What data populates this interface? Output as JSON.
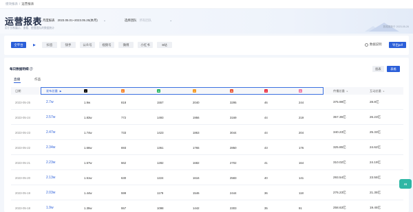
{
  "breadcrumb": {
    "parent": "绩效报表",
    "current": "运营报表"
  },
  "header": {
    "title": "运营报表",
    "subtitle": "用于分析展示、查看、经营团队的数据统计",
    "update_time": "数据更新于 2023-05-26"
  },
  "filters": {
    "period": {
      "label": "月度报表",
      "value": "2023.05.01~2023.05.25(本月)"
    },
    "team": {
      "label": "选择团队",
      "placeholder": "所有团队"
    }
  },
  "platform_filter": {
    "all_label": "全平台",
    "items": [
      "抖音",
      "快手",
      "公众号",
      "视频号",
      "微博",
      "小红书",
      "B站"
    ],
    "explain_label": "数据说明",
    "export_label": "导出pdf"
  },
  "table_section": {
    "title": "每日数据明细",
    "view_chart": "图表",
    "view_table": "表格",
    "subtabs": [
      "直播",
      "作品"
    ],
    "columns": {
      "date": "日期",
      "published": "发布总量",
      "followers": "传播总量",
      "interaction": "互动总量"
    },
    "platform_icons": [
      {
        "name": "douyin-icon",
        "color": "#111111",
        "glyph": "♪"
      },
      {
        "name": "kuaishou-icon",
        "color": "#f5822a",
        "glyph": "K"
      },
      {
        "name": "wechat-official-icon",
        "color": "#22b35e",
        "glyph": "W"
      },
      {
        "name": "channels-icon",
        "color": "#f59b23",
        "glyph": "∞"
      },
      {
        "name": "weibo-icon",
        "color": "#e8502f",
        "glyph": "W"
      },
      {
        "name": "xiaohongshu-icon",
        "color": "#e8283b",
        "glyph": "小"
      },
      {
        "name": "bilibili-icon",
        "color": "#f07aa6",
        "glyph": "B"
      }
    ],
    "rows": [
      {
        "date": "2023-05-25",
        "pub": "2.7w",
        "v": [
          "1.9w",
          "818",
          "1557",
          "2040",
          "3295",
          "46",
          "244"
        ],
        "spread": "375.98亿",
        "interact": "28.8亿"
      },
      {
        "date": "2023-05-24",
        "pub": "2.57w",
        "v": [
          "1.83w",
          "772",
          "1493",
          "1956",
          "3169",
          "44",
          "219"
        ],
        "spread": "357.35亿",
        "interact": "26.23亿"
      },
      {
        "date": "2023-05-23",
        "pub": "2.47w",
        "v": [
          "1.74w",
          "733",
          "1423",
          "1863",
          "3044",
          "44",
          "204"
        ],
        "spread": "340.23亿",
        "interact": "25.33亿"
      },
      {
        "date": "2023-05-22",
        "pub": "2.34w",
        "v": [
          "1.66w",
          "693",
          "1361",
          "1765",
          "2850",
          "43",
          "176"
        ],
        "spread": "325.85亿",
        "interact": "24.62亿"
      },
      {
        "date": "2023-05-21",
        "pub": "2.23w",
        "v": [
          "1.57w",
          "662",
          "1282",
          "1682",
          "2702",
          "41",
          "164"
        ],
        "spread": "310.02亿",
        "interact": "24.19亿"
      },
      {
        "date": "2023-05-20",
        "pub": "2.13w",
        "v": [
          "1.51w",
          "630",
          "1224",
          "1616",
          "2583",
          "40",
          "141"
        ],
        "spread": "293.54亿",
        "interact": "23.55亿"
      },
      {
        "date": "2023-05-19",
        "pub": "2.03w",
        "v": [
          "1.44w",
          "599",
          "1179",
          "1546",
          "2444",
          "36",
          "118"
        ],
        "spread": "276.23亿",
        "interact": "21.35亿"
      },
      {
        "date": "2023-05-18",
        "pub": "1.9w",
        "v": [
          "1.35w",
          "557",
          "1098",
          "1442",
          "2303",
          "35",
          "91"
        ],
        "spread": "258.63亿",
        "interact": "19.45亿"
      }
    ]
  },
  "float_badge": "AI"
}
